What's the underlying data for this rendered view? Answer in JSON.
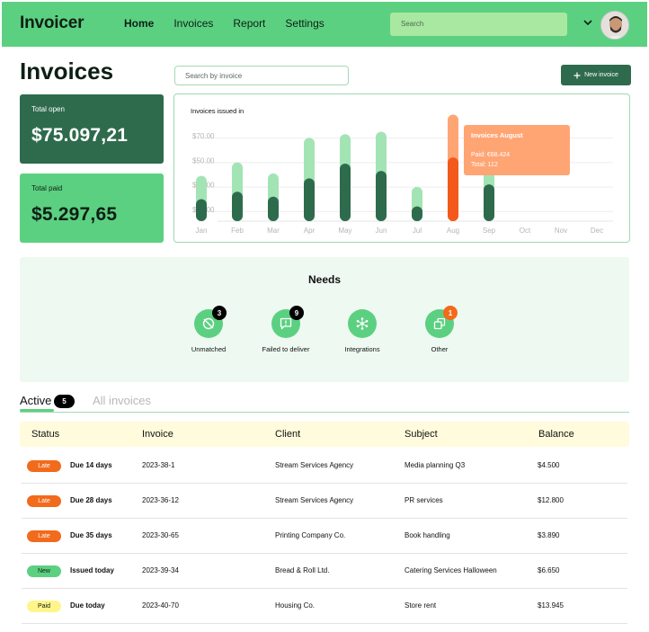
{
  "app": {
    "title": "Invoicer"
  },
  "nav": {
    "items": [
      "Home",
      "Invoices",
      "Report",
      "Settings"
    ],
    "active": "Home"
  },
  "header": {
    "search_placeholder": "Search"
  },
  "page": {
    "title": "Invoices",
    "search_placeholder": "Search by invoice",
    "new_button": "New invoice"
  },
  "stats": {
    "open": {
      "label": "Total open",
      "value": "$75.097,21"
    },
    "paid": {
      "label": "Total paid",
      "value": "$5.297,65"
    }
  },
  "chart_data": {
    "type": "bar",
    "title": "Invoices issued in",
    "categories": [
      "Jan",
      "Feb",
      "Mar",
      "Apr",
      "May",
      "Jun",
      "Jul",
      "Aug",
      "Sep",
      "Oct",
      "Nov",
      "Dec"
    ],
    "y_tick_labels": [
      "$10.00",
      "$30.00",
      "$50.00",
      "$70.00"
    ],
    "ylim": [
      0,
      80
    ],
    "series": [
      {
        "values": [
          37,
          48,
          39,
          68,
          71,
          73,
          28,
          87,
          45,
          null,
          null,
          null
        ]
      },
      {
        "values": [
          18,
          24,
          20,
          35,
          47,
          41,
          12,
          52,
          30,
          null,
          null,
          null
        ]
      }
    ],
    "highlight_index": 7,
    "colors": {
      "light": "#a3e4b5",
      "dark": "#2e6b4c",
      "hl_light": "#ffa574",
      "hl_dark": "#f2591b",
      "grid": "#eeeeee",
      "axis_text": "#b5b5b5"
    },
    "tooltip": {
      "title": "Invoices August",
      "paid": "Paid: €68.424",
      "total": "Total: 112",
      "bg": "#ffa574"
    }
  },
  "needs": {
    "title": "Needs",
    "items": [
      {
        "label": "Unmatched",
        "icon": "unmatched-icon",
        "count": "3",
        "badge_color": "black"
      },
      {
        "label": "Failed to deliver",
        "icon": "message-alert-icon",
        "count": "9",
        "badge_color": "black"
      },
      {
        "label": "Integrations",
        "icon": "integrations-icon",
        "count": "",
        "badge_color": ""
      },
      {
        "label": "Other",
        "icon": "other-icon",
        "count": "1",
        "badge_color": "orange"
      }
    ]
  },
  "tabs": {
    "active_label": "Active",
    "active_count": "5",
    "all_label": "All invoices"
  },
  "table": {
    "headers": [
      "Status",
      "Invoice",
      "Client",
      "Subject",
      "Balance"
    ],
    "rows": [
      {
        "status": "Late",
        "due": "Due 14 days",
        "invoice": "2023-38-1",
        "client": "Stream Services Agency",
        "subject": "Media planning Q3",
        "balance": "$4.500"
      },
      {
        "status": "Late",
        "due": "Due 28 days",
        "invoice": "2023-36-12",
        "client": "Stream Services Agency",
        "subject": "PR services",
        "balance": "$12.800"
      },
      {
        "status": "Late",
        "due": "Due 35 days",
        "invoice": "2023-30-65",
        "client": "Printing Company Co.",
        "subject": "Book handling",
        "balance": "$3.890"
      },
      {
        "status": "New",
        "due": "Issued today",
        "invoice": "2023-39-34",
        "client": "Bread & Roll Ltd.",
        "subject": "Catering Services Halloween",
        "balance": "$6.650"
      },
      {
        "status": "Paid",
        "due": "Due today",
        "invoice": "2023-40-70",
        "client": "Housing Co.",
        "subject": "Store rent",
        "balance": "$13.945"
      }
    ]
  }
}
